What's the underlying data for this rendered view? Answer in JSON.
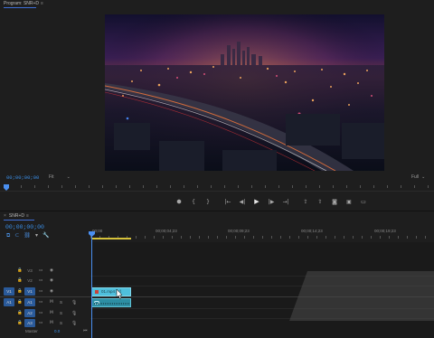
{
  "program": {
    "tab_label": "Program: SNR+D",
    "menu_glyph": "≡",
    "timecode": "00;00;00;00",
    "fit_label": "Fit",
    "fit_caret": "⌄",
    "quality_label": "Full",
    "quality_caret": "⌄",
    "transport": [
      {
        "icon": "marker-icon",
        "glyph": "⬢"
      },
      {
        "icon": "mark-in-icon",
        "glyph": "{"
      },
      {
        "icon": "mark-out-icon",
        "glyph": "}"
      },
      {
        "icon": "go-to-in-icon",
        "glyph": "|←"
      },
      {
        "icon": "step-back-icon",
        "glyph": "◀|"
      },
      {
        "icon": "play-icon",
        "glyph": "▶"
      },
      {
        "icon": "step-forward-icon",
        "glyph": "|▶"
      },
      {
        "icon": "go-to-out-icon",
        "glyph": "→|"
      },
      {
        "icon": "lift-icon",
        "glyph": "⇪"
      },
      {
        "icon": "extract-icon",
        "glyph": "⇧"
      },
      {
        "icon": "export-frame-icon",
        "glyph": "◙"
      },
      {
        "icon": "comparison-view-icon",
        "glyph": "▣"
      },
      {
        "icon": "button-editor-icon",
        "glyph": "▭"
      }
    ]
  },
  "timeline": {
    "tab_close": "×",
    "tab_label": "SNR+D",
    "menu_glyph": "≡",
    "timecode": "00;00;00;00",
    "tools": [
      {
        "icon": "nest-icon",
        "glyph": "⧉",
        "active": true
      },
      {
        "icon": "snap-icon",
        "glyph": "⊂",
        "active": true
      },
      {
        "icon": "linked-selection-icon",
        "glyph": "⛓",
        "active": true
      },
      {
        "icon": "add-marker-icon",
        "glyph": "▾",
        "active": false
      },
      {
        "icon": "settings-wrench-icon",
        "glyph": "🔧",
        "active": false
      }
    ],
    "ruler_labels": [
      "00;00",
      "00;00;04;23",
      "00;00;09;23",
      "00;00;14;23",
      "00;00;19;23"
    ],
    "tracks": [
      {
        "source": "",
        "name": "V3",
        "targeted": false,
        "icon1": "▭",
        "icon2": "◉",
        "icon3": "",
        "icon4": ""
      },
      {
        "source": "",
        "name": "V2",
        "targeted": false,
        "icon1": "▭",
        "icon2": "◉",
        "icon3": "",
        "icon4": ""
      },
      {
        "source": "V1",
        "name": "V1",
        "targeted": true,
        "icon1": "▭",
        "icon2": "◉",
        "icon3": "",
        "icon4": ""
      },
      {
        "source": "A1",
        "name": "A1",
        "targeted": true,
        "icon1": "▭",
        "icon2": "M",
        "icon3": "S",
        "icon4": "🎙"
      },
      {
        "source": "",
        "name": "A2",
        "targeted": true,
        "icon1": "▭",
        "icon2": "M",
        "icon3": "S",
        "icon4": "🎙"
      },
      {
        "source": "",
        "name": "A3",
        "targeted": true,
        "icon1": "▭",
        "icon2": "M",
        "icon3": "S",
        "icon4": "🎙"
      }
    ],
    "lock_glyph": "🔒",
    "master_label": "Master",
    "master_value": "0.0",
    "master_end": "⏮",
    "video_clip_name": "01.mp4 [V]"
  },
  "colors": {
    "accent_blue": "#3a8ee6",
    "clip_video": "#4fc0dc",
    "clip_audio": "#2d8ea3",
    "work_area": "#d6c23a"
  }
}
